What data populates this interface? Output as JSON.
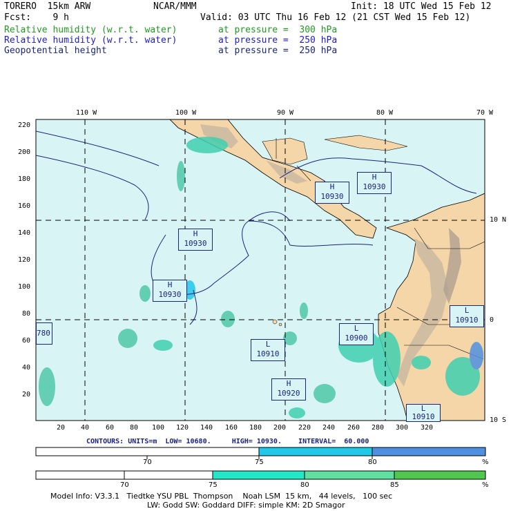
{
  "header": {
    "model": "TORERO  15km ARW",
    "org": "NCAR/MMM",
    "init": "Init: 18 UTC Wed 15 Feb 12",
    "fcst": "Fcst:    9 h",
    "valid": "Valid: 03 UTC Thu 16 Feb 12 (21 CST Wed 15 Feb 12)",
    "fields": [
      {
        "name": "Relative humidity (w.r.t. water)",
        "level": "at pressure =  300 hPa",
        "color": "#1f9a1f"
      },
      {
        "name": "Relative humidity (w.r.t. water)",
        "level": "at pressure =  250 hPa",
        "color": "#1c1ccc"
      },
      {
        "name": "Geopotential height",
        "level": "at pressure =  250 hPa",
        "color": "#1a237e"
      }
    ]
  },
  "map": {
    "lon_labels": [
      "110 W",
      "100 W",
      "90 W",
      "80 W",
      "70 W"
    ],
    "lat_labels_right": [
      "10 N",
      "0",
      "10 S"
    ],
    "y_ticks": [
      "220",
      "200",
      "180",
      "160",
      "140",
      "120",
      "100",
      "80",
      "60",
      "40",
      "20"
    ],
    "x_ticks": [
      "20",
      "40",
      "60",
      "80",
      "100",
      "120",
      "140",
      "160",
      "180",
      "200",
      "220",
      "240",
      "260",
      "280",
      "300",
      "320"
    ],
    "centers": [
      {
        "type": "H",
        "value": "10930"
      },
      {
        "type": "H",
        "value": "10930"
      },
      {
        "type": "H",
        "value": "10930"
      },
      {
        "type": "H",
        "value": "10930"
      },
      {
        "type": "L",
        "value": "10910"
      },
      {
        "type": "L",
        "value": "10900"
      },
      {
        "type": "H",
        "value": "10920"
      },
      {
        "type": "L",
        "value": "10910"
      },
      {
        "type": "L",
        "value": "10910"
      },
      {
        "type": "L",
        "value": "780"
      }
    ],
    "colors": {
      "ocean": "#d8f4f4",
      "land": "#f5d6a8",
      "grid": "#000000"
    }
  },
  "contour_info": "CONTOURS: UNITS=m  LOW= 10680.     HIGH= 10930.    INTERVAL=  60.000",
  "colorbar1": {
    "ticks": [
      "70",
      "75",
      "80"
    ],
    "unit": "%",
    "bins": [
      {
        "from": 65,
        "to": 75,
        "color": "#ffffff"
      },
      {
        "from": 75,
        "to": 80,
        "color": "#22c8e8"
      },
      {
        "from": 80,
        "to": 85,
        "color": "#5090e0"
      }
    ]
  },
  "colorbar2": {
    "ticks": [
      "70",
      "75",
      "80",
      "85"
    ],
    "unit": "%",
    "bins": [
      {
        "from": 65,
        "to": 75,
        "color": "#ffffff"
      },
      {
        "from": 75,
        "to": 80,
        "color": "#22e8c8"
      },
      {
        "from": 80,
        "to": 85,
        "color": "#60e0a0"
      },
      {
        "from": 85,
        "to": 90,
        "color": "#50c850"
      }
    ]
  },
  "footer": {
    "line1": "Model Info: V3.3.1   Tiedtke YSU PBL  Thompson    Noah LSM  15 km,   44 levels,   100 sec",
    "line2": "LW: Godd SW: Goddard DIFF: simple KM: 2D Smagor"
  }
}
